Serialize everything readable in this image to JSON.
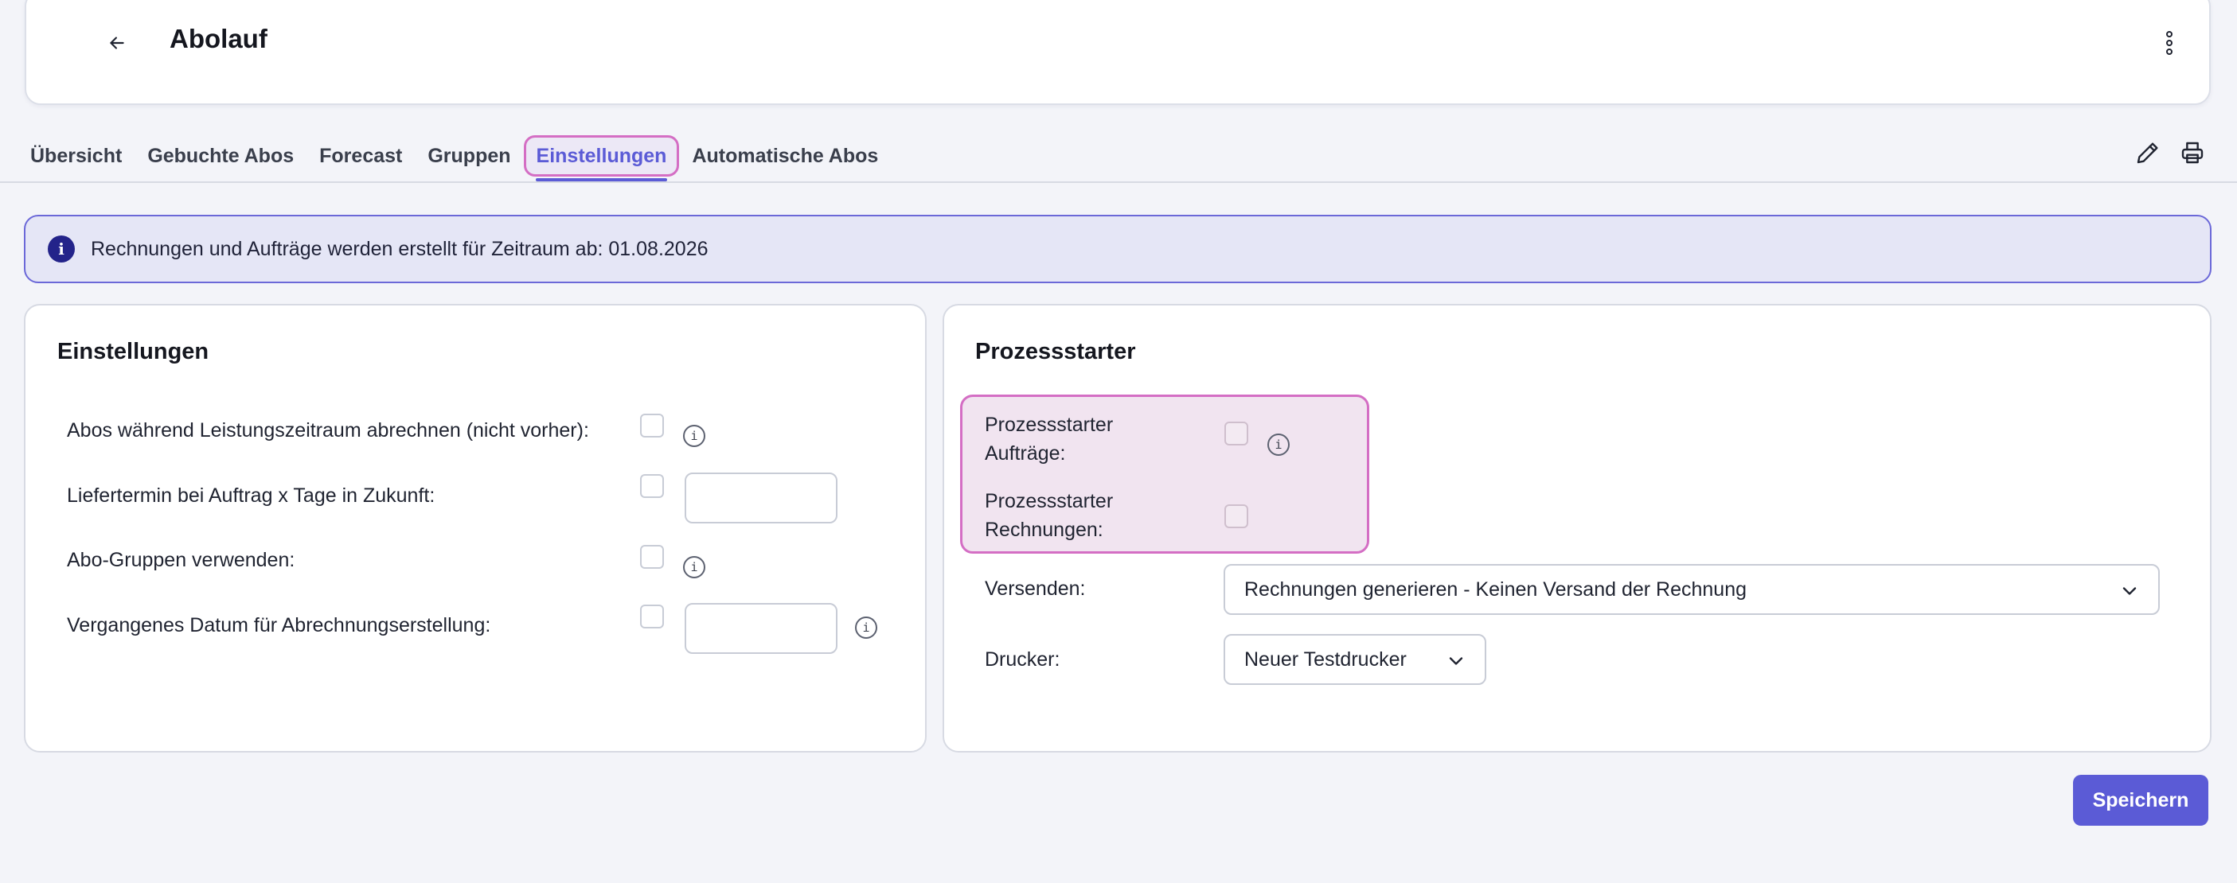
{
  "header": {
    "title": "Abolauf"
  },
  "tabs": [
    {
      "label": "Übersicht"
    },
    {
      "label": "Gebuchte Abos"
    },
    {
      "label": "Forecast"
    },
    {
      "label": "Gruppen"
    },
    {
      "label": "Einstellungen"
    },
    {
      "label": "Automatische Abos"
    }
  ],
  "active_tab": "Einstellungen",
  "banner": {
    "text": "Rechnungen und Aufträge werden erstellt für Zeitraum ab: 01.08.2026",
    "icon": "i"
  },
  "settings": {
    "title": "Einstellungen",
    "rows": [
      {
        "label": "Abos während Leistungszeitraum abrechnen (nicht vorher):"
      },
      {
        "label": "Liefertermin bei Auftrag x Tage in Zukunft:"
      },
      {
        "label": "Abo-Gruppen verwenden:"
      },
      {
        "label": "Vergangenes Datum für Abrechnungserstellung:"
      }
    ]
  },
  "process": {
    "title": "Prozessstarter",
    "orders_label_1": "Prozessstarter",
    "orders_label_2": "Aufträge:",
    "invoices_label_1": "Prozessstarter",
    "invoices_label_2": "Rechnungen:",
    "send_label": "Versenden:",
    "send_value": "Rechnungen generieren - Keinen Versand der Rechnung",
    "printer_label": "Drucker:",
    "printer_value": "Neuer Testdrucker"
  },
  "info_glyph": "i",
  "save_label": "Speichern",
  "colors": {
    "accent": "#5b5bd6",
    "highlight": "#d46ec4",
    "banner_bg": "#e5e6f6"
  }
}
